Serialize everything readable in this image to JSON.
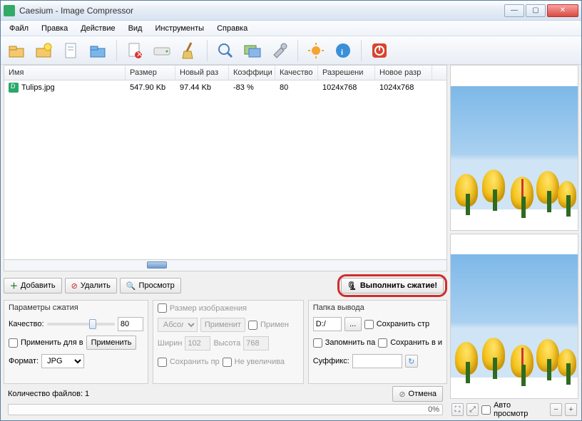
{
  "window": {
    "title": "Caesium - Image Compressor"
  },
  "menu": [
    "Файл",
    "Правка",
    "Действие",
    "Вид",
    "Инструменты",
    "Справка"
  ],
  "toolbar_icons": [
    "open-folder-icon",
    "new-project-icon",
    "document-icon",
    "save-folder-icon",
    "sep",
    "page-delete-icon",
    "drive-icon",
    "broom-icon",
    "sep",
    "magnifier-icon",
    "images-icon",
    "tools-icon",
    "sep",
    "sun-icon",
    "info-icon",
    "sep",
    "power-icon"
  ],
  "columns": {
    "name": "Имя",
    "size": "Размер",
    "nsize": "Новый раз",
    "ratio": "Коэффици",
    "quality": "Качество",
    "res": "Разрешени",
    "nres": "Новое разр"
  },
  "rows": [
    {
      "name": "Tulips.jpg",
      "size": "547.90 Kb",
      "nsize": "97.44 Kb",
      "ratio": "-83 %",
      "quality": "80",
      "res": "1024x768",
      "nres": "1024x768"
    }
  ],
  "buttons": {
    "add": "Добавить",
    "remove": "Удалить",
    "preview": "Просмотр",
    "compress": "Выполнить сжатие!",
    "apply": "Применить",
    "browse": "...",
    "cancel": "Отмена"
  },
  "compression": {
    "title": "Параметры сжатия",
    "quality_label": "Качество:",
    "quality_value": "80",
    "apply_all": "Применить для в",
    "format_label": "Формат:",
    "format_value": "JPG"
  },
  "resize": {
    "title": "Размер изображения",
    "abs": "Абсолн",
    "apply_btn": "Применит",
    "apply_chk": "Примен",
    "w_label": "Ширин",
    "w_val": "102",
    "h_label": "Высота",
    "h_val": "768",
    "keep": "Сохранить пр",
    "noenlarge": "Не увеличива"
  },
  "output": {
    "title": "Папка вывода",
    "path": "D:/",
    "keep_struct": "Сохранить стр",
    "remember": "Запомнить па",
    "save_in": "Сохранить в и",
    "suffix_label": "Суффикс:",
    "suffix_value": ""
  },
  "footer": {
    "count_label": "Количество файлов: 1",
    "percent": "0%"
  },
  "right": {
    "auto": "Авто просмотр"
  }
}
